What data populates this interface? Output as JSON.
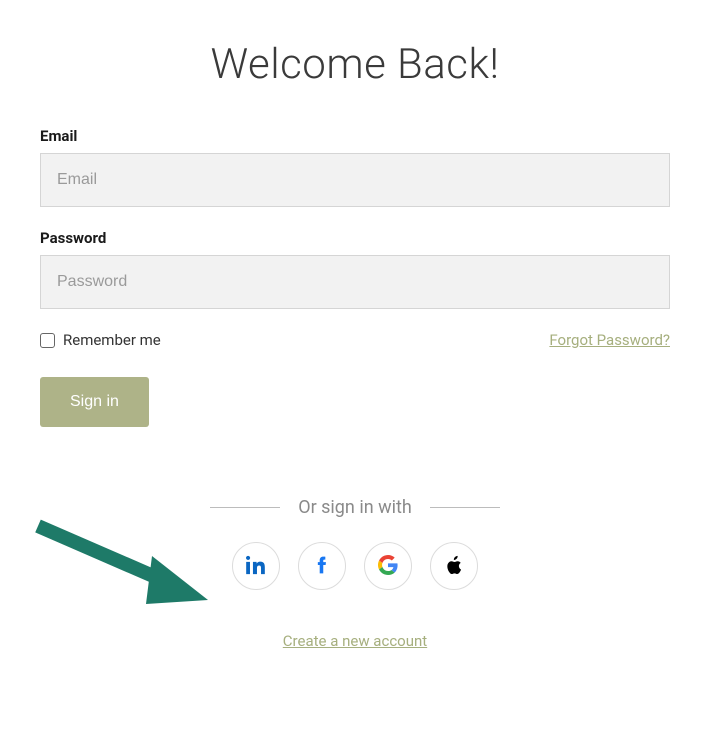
{
  "heading": "Welcome Back!",
  "email": {
    "label": "Email",
    "placeholder": "Email",
    "value": ""
  },
  "password": {
    "label": "Password",
    "placeholder": "Password",
    "value": ""
  },
  "remember": {
    "label": "Remember me",
    "checked": false
  },
  "forgot_link": "Forgot Password?",
  "signin_button": "Sign in",
  "divider_text": "Or sign in with",
  "social": {
    "linkedin": "linkedin-icon",
    "facebook": "facebook-icon",
    "google": "google-icon",
    "apple": "apple-icon"
  },
  "create_account": "Create a new account",
  "colors": {
    "accent": "#aeb388",
    "link": "#a6af7e",
    "input_bg": "#f2f2f2",
    "annotation_arrow": "#1e7a68"
  }
}
